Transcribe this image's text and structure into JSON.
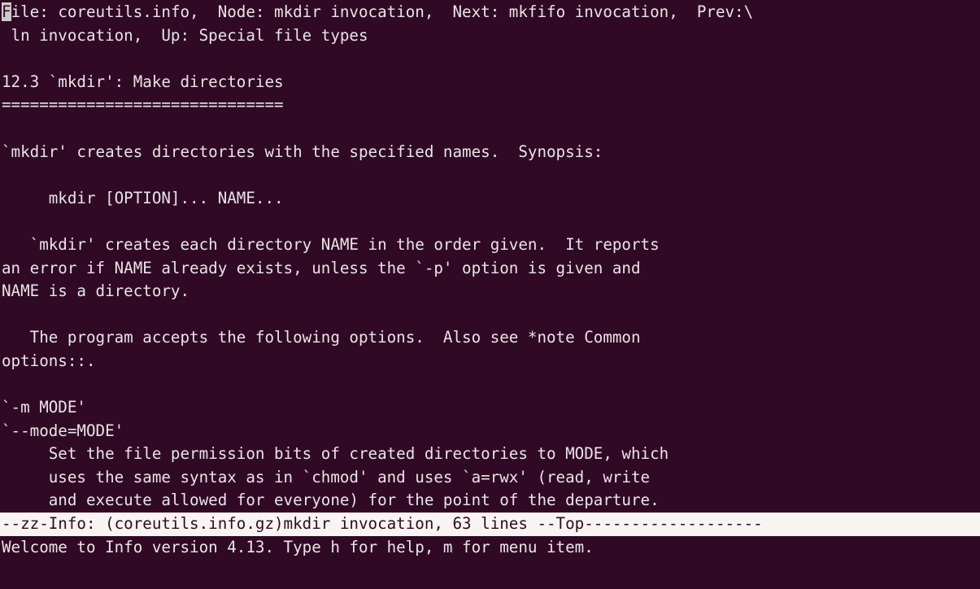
{
  "terminal": {
    "app": "GNU Info",
    "background_color": "#300a24",
    "foreground_color": "#e9e4e7",
    "modeline_background_color": "#f7f4f2",
    "modeline_foreground_color": "#300a24",
    "cursor_color": "#cfc8cb",
    "columns": 79,
    "rows": 25
  },
  "header": {
    "cursor_char": "F",
    "line1_rest": "ile: coreutils.info,  Node: mkdir invocation,  Next: mkfifo invocation,  Prev:\\",
    "line2": " ln invocation,  Up: Special file types"
  },
  "content": {
    "lines": [
      "",
      "12.3 `mkdir': Make directories",
      "==============================",
      "",
      "`mkdir' creates directories with the specified names.  Synopsis:",
      "",
      "     mkdir [OPTION]... NAME...",
      "",
      "   `mkdir' creates each directory NAME in the order given.  It reports",
      "an error if NAME already exists, unless the `-p' option is given and",
      "NAME is a directory.",
      "",
      "   The program accepts the following options.  Also see *note Common",
      "options::.",
      "",
      "`-m MODE'",
      "`--mode=MODE'",
      "     Set the file permission bits of created directories to MODE, which",
      "     uses the same syntax as in `chmod' and uses `a=rwx' (read, write",
      "     and execute allowed for everyone) for the point of the departure."
    ]
  },
  "modeline": {
    "text": "--zz-Info: (coreutils.info.gz)mkdir invocation, 63 lines --Top-------------------",
    "file": "coreutils.info.gz",
    "node": "mkdir invocation",
    "line_count": "63 lines",
    "position": "--Top"
  },
  "echo_area": {
    "message": "Welcome to Info version 4.13. Type h for help, m for menu item."
  }
}
